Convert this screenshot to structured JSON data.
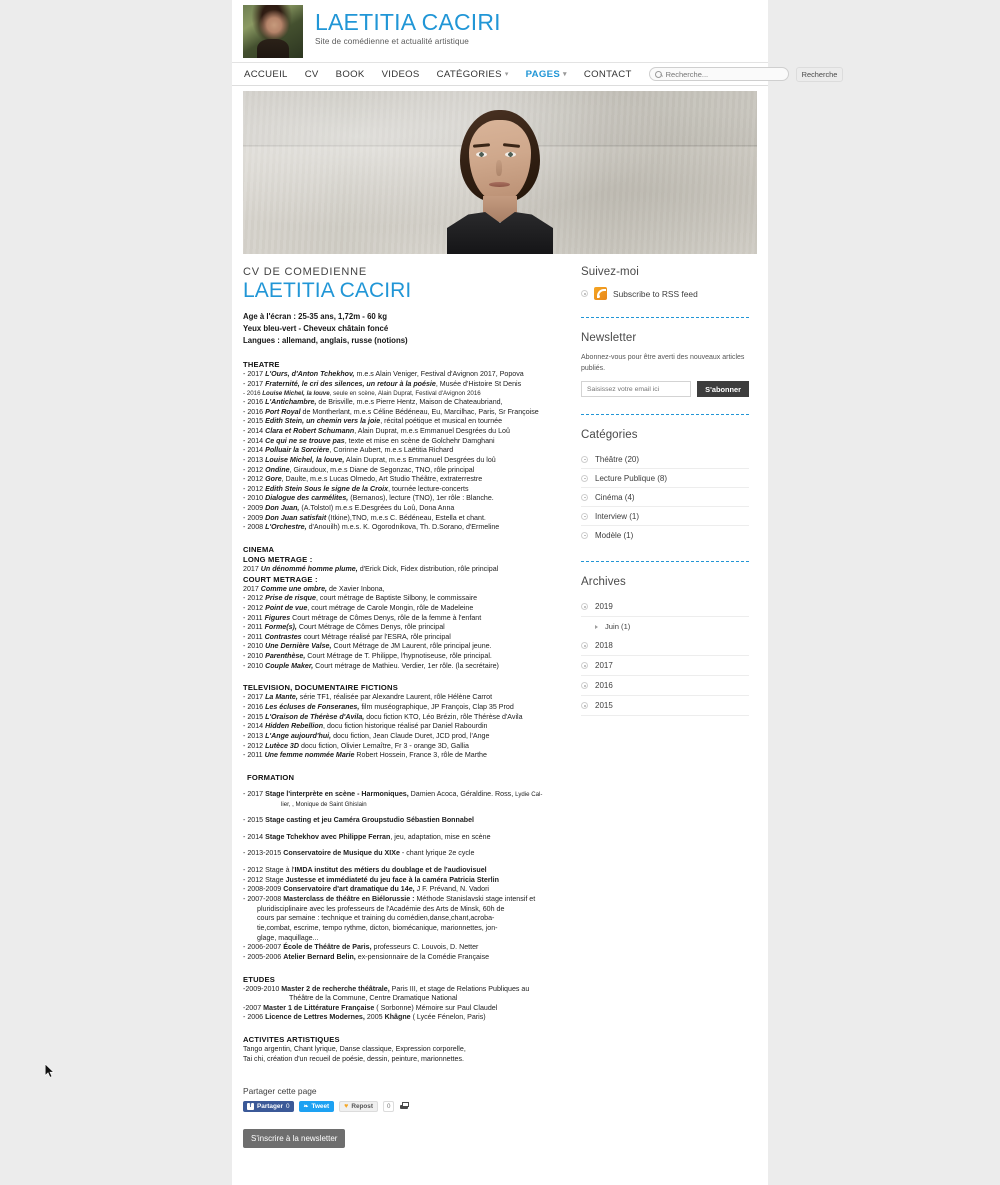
{
  "site": {
    "brand_title": "LAETITIA CACIRI",
    "brand_subtitle": "Site de comédienne et actualité artistique",
    "avatar_alt": "portrait-avatar"
  },
  "nav": {
    "items": [
      {
        "label": "ACCUEIL",
        "active": false,
        "caret": false
      },
      {
        "label": "CV",
        "active": false,
        "caret": false
      },
      {
        "label": "BOOK",
        "active": false,
        "caret": false
      },
      {
        "label": "VIDEOS",
        "active": false,
        "caret": false
      },
      {
        "label": "CATÉGORIES",
        "active": false,
        "caret": true
      },
      {
        "label": "PAGES",
        "active": true,
        "caret": true
      },
      {
        "label": "CONTACT",
        "active": false,
        "caret": false
      }
    ],
    "search_placeholder": "Recherche...",
    "search_value": "",
    "search_button": "Recherche"
  },
  "cv": {
    "kicker": "CV DE COMEDIENNE",
    "name": "LAETITIA CACIRI",
    "identity": [
      "Age à l'écran : 25-35 ans, 1,72m - 60 kg",
      "Yeux bleu-vert - Cheveux châtain foncé",
      "Langues : allemand, anglais, russe (notions)"
    ],
    "theatre": {
      "title": "THEATRE",
      "items": [
        "- 2017 <t>L'Ours, d'Anton Tchekhov,</t> m.e.s Alain Veniger, Festival d'Avignon 2017, Popova",
        "- 2017 <t>Fraternité, le cri des silences, un retour à la poésie</t>, Musée d'Histoire St Denis",
        "- 2016 <t>Louise Michel, la louve</t>, seule en scène, Alain Duprat, Festival d'Avignon 2016",
        "- 2016 <t>L'Antichambre,</t> de Brisville, m.e.s Pierre Hentz, Maison de Chateaubriand,",
        "- 2016 <t>Port Royal</t> de Montherlant, m.e.s Céline Bédéneau, Eu, Marcilhac, Paris, Sr Françoise",
        "- 2015 <t>Edith Stein, un chemin vers la joie</t>, récital poétique et musical en tournée",
        "- 2014 <t>Clara et Robert Schumann</t>, Alain Duprat, m.e.s Emmanuel Desgrées du Loû",
        "- 2014 <t>Ce qui ne se trouve pas</t>, texte et mise en scène de Golchehr Damghani",
        "- 2014 <t>Polluair la Sorcière</t>, Corinne Aubert, m.e.s Laëtitia Richard",
        "- 2013 <t>Louise Michel, la louve,</t> Alain Duprat, m.e.s Emmanuel Desgrées du loû",
        "- 2012 <t>Ondine</t>, Giraudoux, m.e.s Diane de Segonzac, TNO, rôle principal",
        "- 2012 <t>Gore</t>, Daulte, m.e.s Lucas Olmedo, Art Studio Théâtre, extraterrestre",
        "- 2012 <t>Edith Stein Sous le signe de la Croix</t>, tournée lecture-concerts",
        "- 2010 <t>Dialogue des carmélites,</t> (Bernanos), lecture (TNO), 1er rôle : Blanche.",
        "- 2009 <t>Don Juan,</t> (A.Tolstoï) m.e.s E.Desgrées du Loû,  Dona Anna",
        "- 2009  <t>Don Juan satisfait</t> (Itkine),TNO, m.e.s C. Bédéneau, Estella et chant.",
        "- 2008  <t>L'Orchestre,</t> d'Anouilh) m.e.s. K. Ogorodnikova, Th. D.Sorano, d'Ermeline"
      ],
      "small_index": 2
    },
    "cinema": {
      "title": "CINEMA",
      "long_label": "LONG METRAGE :",
      "long_items": [
        "2017 <t>Un dénommé homme plume,</t> d'Erick Dick, Fidex distribution, rôle principal"
      ],
      "short_label": "COURT METRAGE :",
      "short_items": [
        "2017 <t>Comme une ombre,</t> de Xavier Inbona,",
        "- 2012 <t>Prise de risque</t>, court métrage de Baptiste Silbony, le commissaire",
        "- 2012 <t>Point de vue</t>, court métrage de Carole Mongin, rôle de Madeleine",
        "- 2011 <t>Figures</t> Court métrage de Cômes Denys, rôle de la femme à l'enfant",
        "- 2011 <t>Forme(s),</t> Court Métrage de Cômes Denys, rôle principal",
        "-  2011 <t>Contrastes</t> court Métrage réalisé par l'ESRA, rôle principal",
        "- 2010 <t>Une Dernière Valse,</t> Court Métrage de JM Laurent, rôle principal jeune.",
        "- 2010 <t>Parenthèse,</t> Court Métrage de T. Philippe, l'hypnotiseuse, rôle principal.",
        "- 2010  <t>Couple Maker,</t> Court métrage de Mathieu. Verdier, 1er rôle. (la secrétaire)"
      ]
    },
    "television": {
      "title": "TELEVISION, DOCUMENTAIRE FICTIONS",
      "items": [
        "- 2017 <t>La Mante,</t> série TF1, réalisée par Alexandre Laurent, rôle Hélène Carrot",
        "- 2016 <t>Les écluses de Fonseranes,</t> film muséographique, JP François, Clap 35 Prod",
        "- 2015 <t>L'Oraison de Thérèse d'Avila,</t> docu fiction KTO, Léo Brézin, rôle Thérèse d'Avila",
        "- 2014 <t>Hidden Rebellion</t>, docu fiction historique réalisé par Daniel Rabourdin",
        "- 2013 <t>L'Ange aujourd'hui,</t> docu fiction, Jean Claude Duret, JCD prod, l'Ange",
        "- 2012 <t>Lutèce 3D</t> docu fiction, Olivier Lemaître, Fr 3 - orange 3D, Gallia",
        "- 2011  <t>Une femme nommée Marie</t> Robert Hossein, France 3, rôle de Marthe"
      ]
    },
    "formation": {
      "title": "FORMATION",
      "items": [
        "- 2017 <bb>Stage l'interprète en scène - Harmoniques,</bb> Damien Acoca, Géraldine. Ross, <tiny>Lydie Cal-</tiny>",
        "<tiny>lier, , Monique de Saint Ghislain</tiny>",
        "- 2015 <bb>Stage casting et jeu Caméra Groupstudio Sébastien Bonnabel</bb>",
        "- 2014 <bb>Stage Tchekhov avec Philippe Ferran</bb>, jeu, adaptation, mise en scène",
        "- 2013-2015 <bb>Conservatoire de Musique du XIXe</bb> - chant lyrique 2e cycle",
        "- 2012 Stage à l'<bb>IMDA institut des métiers du doublage et de l'audiovisuel</bb>",
        "- 2012 Stage <bb>Justesse et immédiateté du jeu face à la caméra Patricia Sterlin</bb>",
        "- 2008-2009 <bb>Conservatoire d'art dramatique du 14e,</bb> J F. Prévand, N. Vadori",
        "- 2007-2008 <bb>Masterclass de théâtre en Biélorussie :</bb> Méthode Stanislavski stage intensif et",
        "pluridisciplinaire avec les professeurs de l'Académie des Arts de Minsk, 60h de",
        "cours par semaine : technique et training du comédien,danse,chant,acroba-",
        "tie,combat, escrime, tempo rythme, dicton, biomécanique, marionnettes, jon-",
        "glage, maquillage...",
        "- 2006-2007 <bb>École de Théâtre de Paris,</bb> professeurs C. Louvois, D. Netter",
        "- 2005-2006 <bb>Atelier Bernard Belin,</bb> ex-pensionnaire de la Comédie Française"
      ]
    },
    "etudes": {
      "title": "ETUDES",
      "items": [
        "-2009-2010  <bb>Master 2 de recherche théâtrale,</bb> Paris III, et stage de Relations Publiques au",
        "Théâtre de la Commune, Centre Dramatique National",
        "-2007 <bb>Master 1 de Littérature Française</bb> ( Sorbonne) Mémoire sur Paul Claudel",
        "- 2006 <bb>Licence de Lettres Modernes,</bb> 2005 <bb>Khâgne</bb> ( Lycée Fénelon, Paris)"
      ]
    },
    "activites": {
      "title": "ACTIVITES ARTISTIQUES",
      "items": [
        "Tango argentin, Chant lyrique, Danse classique, Expression corporelle,",
        "Tai chi, création d'un recueil de poésie, dessin, peinture, marionnettes."
      ]
    }
  },
  "sidebar": {
    "follow": {
      "title": "Suivez-moi",
      "rss_label": "Subscribe to RSS feed"
    },
    "newsletter": {
      "title": "Newsletter",
      "description": "Abonnez-vous pour être averti des nouveaux articles publiés.",
      "input_placeholder": "Saisissez votre email ici",
      "input_value": "",
      "button": "S'abonner"
    },
    "categories": {
      "title": "Catégories",
      "items": [
        "Théâtre (20)",
        "Lecture Publique (8)",
        "Cinéma (4)",
        "Interview (1)",
        "Modèle (1)"
      ]
    },
    "archives": {
      "title": "Archives",
      "items": [
        {
          "label": "2019",
          "sub": false
        },
        {
          "label": "Juin (1)",
          "sub": true
        },
        {
          "label": "2018",
          "sub": false
        },
        {
          "label": "2017",
          "sub": false
        },
        {
          "label": "2016",
          "sub": false
        },
        {
          "label": "2015",
          "sub": false
        }
      ]
    }
  },
  "share": {
    "title": "Partager cette page",
    "facebook_label": "Partager",
    "facebook_count": "0",
    "facebook_glyph": "f",
    "twitter_label": "Tweet",
    "twitter_glyph": "❧",
    "repost_label": "Repost",
    "repost_count": "0",
    "print_icon": "printer-icon"
  },
  "footer": {
    "newsletter_cta": "S'inscrire à la newsletter"
  },
  "colors": {
    "accent": "#2196d6",
    "page_bg": "#ececec",
    "rss_orange": "#f5a623"
  }
}
